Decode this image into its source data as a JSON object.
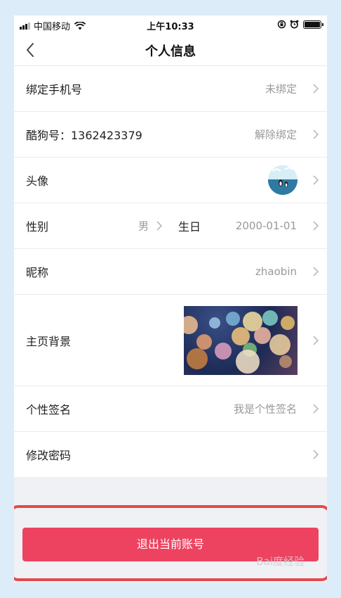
{
  "status_bar": {
    "carrier": "中国移动",
    "time": "上午10:33"
  },
  "nav": {
    "title": "个人信息"
  },
  "rows": {
    "phone": {
      "label": "绑定手机号",
      "value": "未绑定"
    },
    "kugou": {
      "label": "酷狗号：1362423379",
      "value": "解除绑定"
    },
    "avatar": {
      "label": "头像"
    },
    "gender": {
      "label": "性别",
      "value": "男"
    },
    "birthday": {
      "label": "生日",
      "value": "2000-01-01"
    },
    "nickname": {
      "label": "昵称",
      "value": "zhaobin"
    },
    "background": {
      "label": "主页背景"
    },
    "signature": {
      "label": "个性签名",
      "value": "我是个性签名"
    },
    "password": {
      "label": "修改密码"
    }
  },
  "logout": {
    "label": "退出当前账号"
  },
  "watermark": "Bai度经验",
  "colors": {
    "accent": "#ee4360",
    "highlight_border": "#e24a4d",
    "page_background": "#dcedf9"
  }
}
